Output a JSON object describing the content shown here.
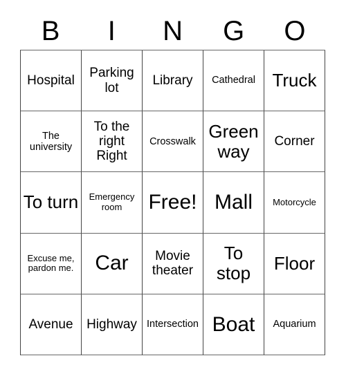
{
  "card": {
    "title": "BINGO",
    "header_letters": [
      "B",
      "I",
      "N",
      "G",
      "O"
    ],
    "border_color": "#444444",
    "text_color": "#000000",
    "background_color": "#ffffff",
    "rows": [
      [
        {
          "text": "Hospital",
          "size": "md"
        },
        {
          "text": "Parking lot",
          "size": "md"
        },
        {
          "text": "Library",
          "size": "md"
        },
        {
          "text": "Cathedral",
          "size": "sm"
        },
        {
          "text": "Truck",
          "size": "lg"
        }
      ],
      [
        {
          "text": "The university",
          "size": "sm"
        },
        {
          "text": "To the right Right",
          "size": "md"
        },
        {
          "text": "Crosswalk",
          "size": "sm"
        },
        {
          "text": "Green way",
          "size": "lg"
        },
        {
          "text": "Corner",
          "size": "md"
        }
      ],
      [
        {
          "text": "To turn",
          "size": "lg"
        },
        {
          "text": "Emergency room",
          "size": "xs"
        },
        {
          "text": "Free!",
          "size": "xl"
        },
        {
          "text": "Mall",
          "size": "xl"
        },
        {
          "text": "Motorcycle",
          "size": "xs"
        }
      ],
      [
        {
          "text": "Excuse me, pardon me.",
          "size": "xs"
        },
        {
          "text": "Car",
          "size": "xl"
        },
        {
          "text": "Movie theater",
          "size": "md"
        },
        {
          "text": "To stop",
          "size": "lg"
        },
        {
          "text": "Floor",
          "size": "lg"
        }
      ],
      [
        {
          "text": "Avenue",
          "size": "md"
        },
        {
          "text": "Highway",
          "size": "md"
        },
        {
          "text": "Intersection",
          "size": "sm"
        },
        {
          "text": "Boat",
          "size": "xl"
        },
        {
          "text": "Aquarium",
          "size": "sm"
        }
      ]
    ]
  }
}
